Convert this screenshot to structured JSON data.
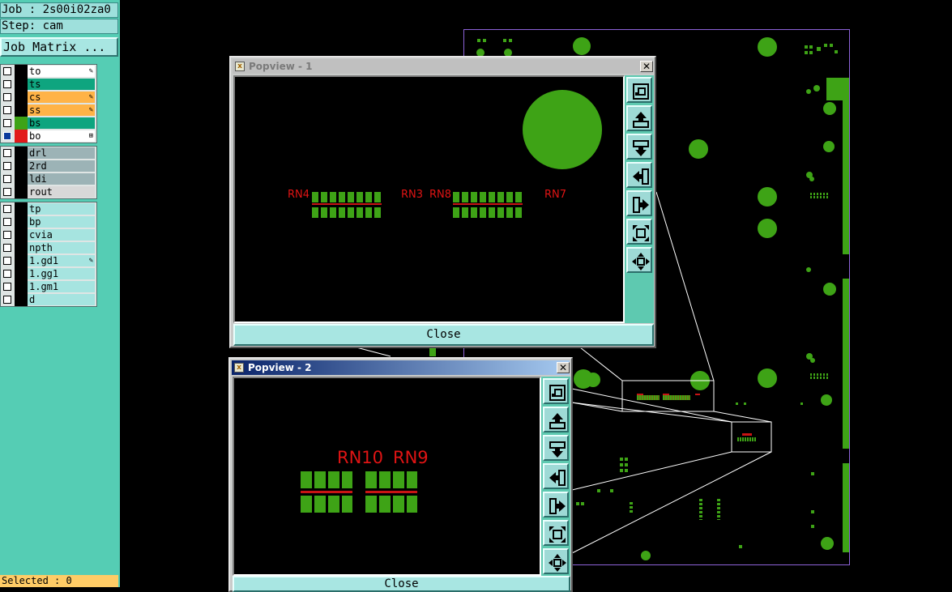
{
  "left_panel": {
    "job": "Job : 2s00i02za0",
    "step": "Step: cam",
    "job_matrix_label": "Job Matrix ...",
    "layers_group1": [
      {
        "name": "to",
        "color": "#ffffff",
        "swatch": "#000000",
        "checked": false,
        "mark": "✎"
      },
      {
        "name": "ts",
        "color": "#0ea57f",
        "swatch": "#000000",
        "checked": false,
        "mark": ""
      },
      {
        "name": "cs",
        "color": "#ffb347",
        "swatch": "#000000",
        "checked": false,
        "mark": "✎"
      },
      {
        "name": "ss",
        "color": "#ffb347",
        "swatch": "#000000",
        "checked": false,
        "mark": "✎"
      },
      {
        "name": "bs",
        "color": "#0ea57f",
        "swatch": "#3ea316",
        "checked": false,
        "mark": ""
      },
      {
        "name": "bo",
        "color": "#ffffff",
        "swatch": "#e21a1a",
        "checked": true,
        "mark": "⊞"
      }
    ],
    "layers_group2": [
      {
        "name": "drl",
        "color": "#9cb3b6",
        "checked": false
      },
      {
        "name": "2rd",
        "color": "#9cb3b6",
        "checked": false
      },
      {
        "name": "ldi",
        "color": "#9cb3b6",
        "checked": false
      },
      {
        "name": "rout",
        "color": "#d8d8d8",
        "checked": false
      }
    ],
    "layers_group3": [
      {
        "name": "tp",
        "checked": false,
        "mark": ""
      },
      {
        "name": "bp",
        "checked": false,
        "mark": ""
      },
      {
        "name": "cvia",
        "checked": false,
        "mark": ""
      },
      {
        "name": "npth",
        "checked": false,
        "mark": ""
      },
      {
        "name": "1.gd1",
        "checked": false,
        "mark": "✎"
      },
      {
        "name": "1.gg1",
        "checked": false,
        "mark": ""
      },
      {
        "name": "1.gm1",
        "checked": false,
        "mark": ""
      },
      {
        "name": "d",
        "checked": false,
        "mark": ""
      }
    ],
    "status": "Selected : 0"
  },
  "popview1": {
    "title": "Popview - 1",
    "close_label": "Close",
    "labels": [
      "RN4",
      "RN3",
      "RN8",
      "RN7"
    ]
  },
  "popview2": {
    "title": "Popview - 2",
    "close_label": "Close",
    "labels": [
      "RN10",
      "RN9"
    ]
  },
  "toolbar_icons": [
    "zoom-home-icon",
    "pan-up-icon",
    "pan-down-icon",
    "pan-left-icon",
    "pan-right-icon",
    "zoom-in-icon",
    "zoom-out-icon"
  ],
  "colors": {
    "panel": "#55cdb4",
    "copper": "#3ea316",
    "outline": "#8d62d8",
    "label": "#e01414"
  }
}
